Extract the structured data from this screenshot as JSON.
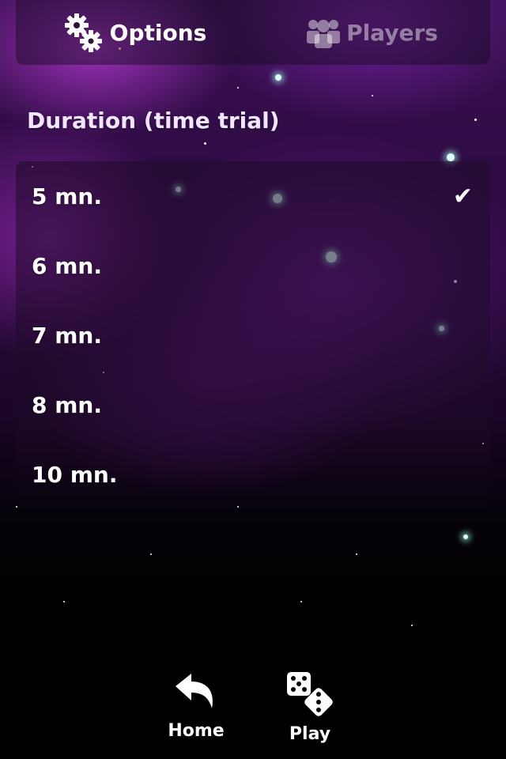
{
  "tabs": [
    {
      "label": "Options",
      "icon": "gears-icon",
      "active": true
    },
    {
      "label": "Players",
      "icon": "players-icon",
      "active": false
    }
  ],
  "section": {
    "title": "Duration (time trial)"
  },
  "durations": [
    {
      "label": "5 mn.",
      "selected": true
    },
    {
      "label": "6 mn.",
      "selected": false
    },
    {
      "label": "7 mn.",
      "selected": false
    },
    {
      "label": "8 mn.",
      "selected": false
    },
    {
      "label": "10 mn.",
      "selected": false
    }
  ],
  "check_glyph": "✔",
  "bottom_nav": {
    "home_label": "Home",
    "play_label": "Play"
  }
}
